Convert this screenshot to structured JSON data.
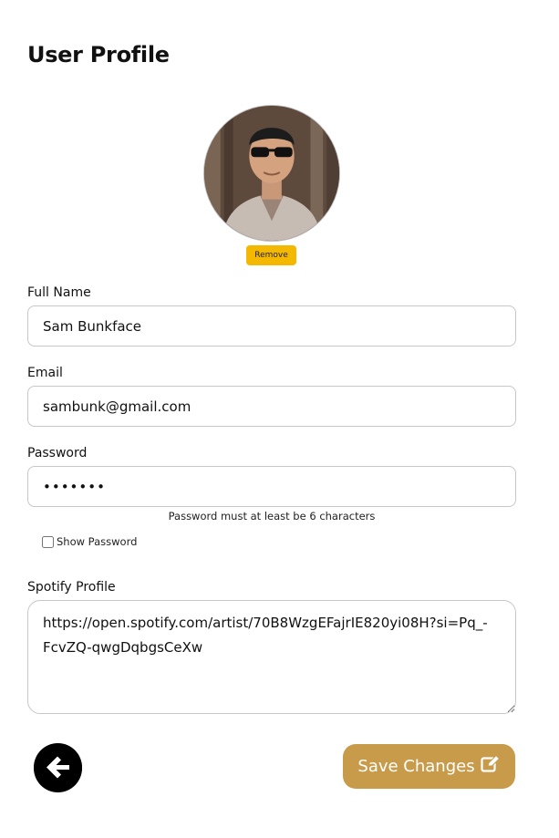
{
  "page": {
    "title": "User Profile"
  },
  "avatar": {
    "remove_label": "Remove"
  },
  "form": {
    "full_name": {
      "label": "Full Name",
      "value": "Sam Bunkface"
    },
    "email": {
      "label": "Email",
      "value": "sambunk@gmail.com"
    },
    "password": {
      "label": "Password",
      "value": "•••••••",
      "helper": "Password must at least be 6 characters",
      "show_label": "Show Password",
      "show_checked": false
    },
    "spotify": {
      "label": "Spotify Profile",
      "value": "https://open.spotify.com/artist/70B8WzgEFajrIE820yi08H?si=Pq_-FcvZQ-qwgDqbgsCeXw"
    }
  },
  "actions": {
    "back_icon": "arrow-left-circle-icon",
    "save_label": "Save Changes",
    "save_icon": "edit-icon"
  },
  "colors": {
    "remove_button": "#f5b800",
    "save_button": "#c89b4b",
    "back_button": "#000000"
  }
}
